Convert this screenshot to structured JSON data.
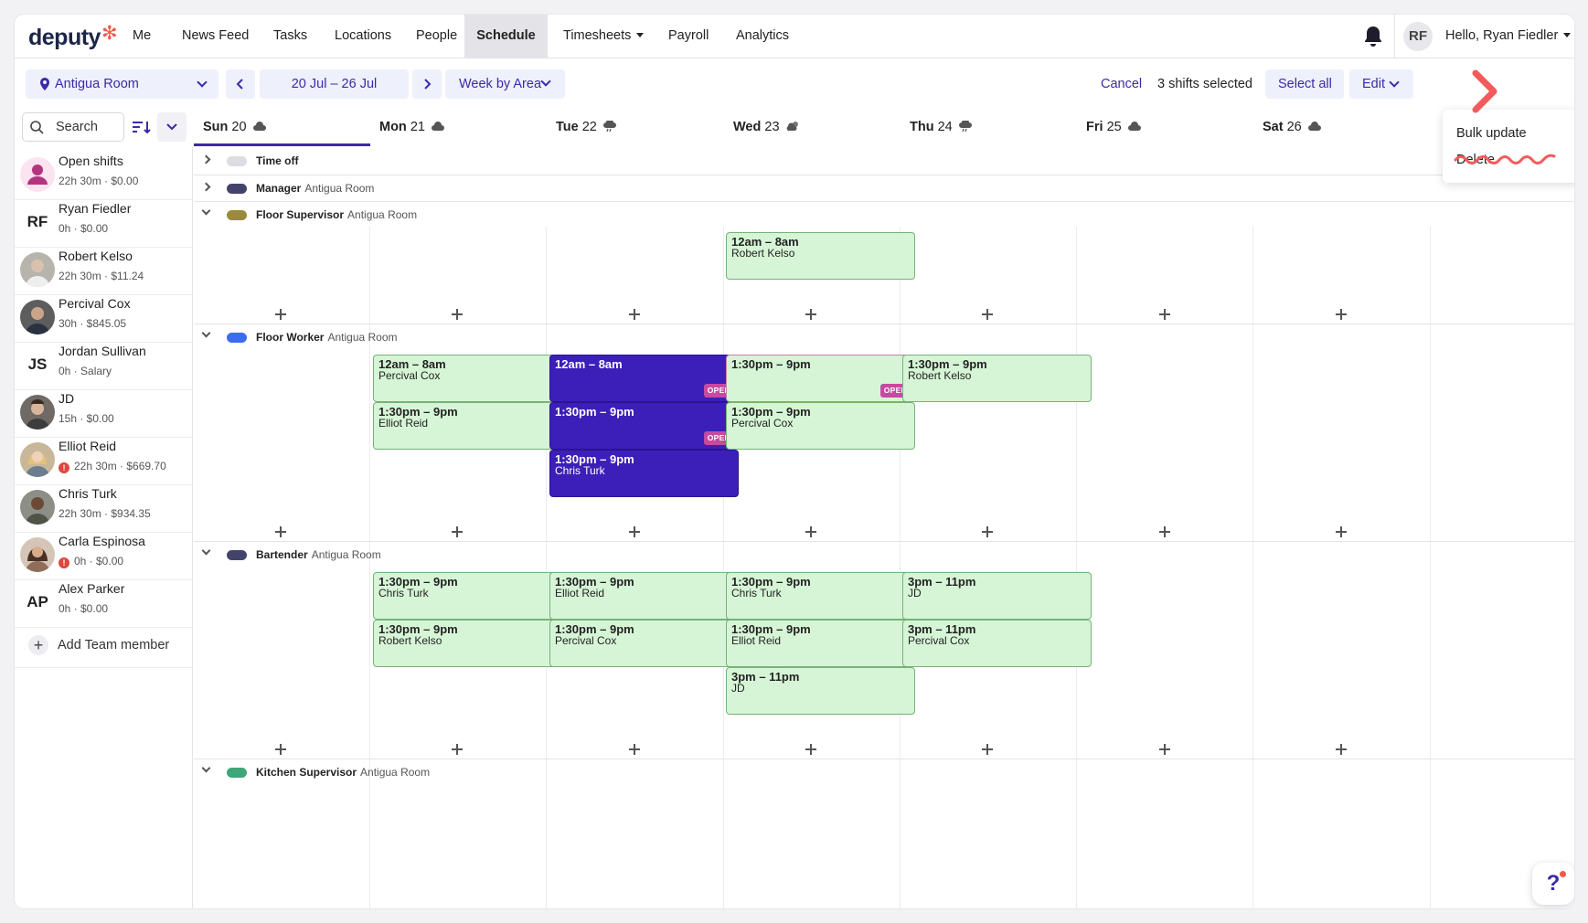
{
  "brand": {
    "name": "deputy",
    "accent": "#3c2aa8",
    "logo_star": "#f25b4b"
  },
  "nav": {
    "items": [
      {
        "label": "Me"
      },
      {
        "label": "News Feed"
      },
      {
        "label": "Tasks"
      },
      {
        "label": "Locations"
      },
      {
        "label": "People"
      },
      {
        "label": "Schedule",
        "active": true
      },
      {
        "label": "Timesheets",
        "dropdown": true
      },
      {
        "label": "Payroll"
      },
      {
        "label": "Analytics"
      }
    ],
    "user_initials": "RF",
    "greeting": "Hello, Ryan Fiedler",
    "bell_icon": "bell-icon"
  },
  "toolbar": {
    "location": "Antigua Room",
    "date_range": "20 Jul – 26 Jul",
    "view": "Week by Area",
    "cancel": "Cancel",
    "selected_count": "3 shifts selected",
    "select_all": "Select all",
    "edit": "Edit"
  },
  "edit_menu": {
    "items": [
      "Bulk update",
      "Delete"
    ]
  },
  "search": {
    "placeholder": "Search"
  },
  "days": [
    {
      "label": "Sun",
      "num": "20",
      "weather": "cloud-icon"
    },
    {
      "label": "Mon",
      "num": "21",
      "weather": "cloud-icon"
    },
    {
      "label": "Tue",
      "num": "22",
      "weather": "rain-icon"
    },
    {
      "label": "Wed",
      "num": "23",
      "weather": "partly-sunny-icon"
    },
    {
      "label": "Thu",
      "num": "24",
      "weather": "rain-icon"
    },
    {
      "label": "Fri",
      "num": "25",
      "weather": "cloud-icon"
    },
    {
      "label": "Sat",
      "num": "26",
      "weather": "cloud-icon"
    }
  ],
  "members": [
    {
      "name": "Open shifts",
      "meta": "22h 30m · $0.00",
      "avatar": "open-shifts-icon"
    },
    {
      "name": "Ryan Fiedler",
      "meta": "0h · $0.00",
      "initials": "RF"
    },
    {
      "name": "Robert Kelso",
      "meta": "22h 30m · $11.24",
      "avatar": "photo"
    },
    {
      "name": "Percival Cox",
      "meta": "30h · $845.05",
      "avatar": "photo"
    },
    {
      "name": "Jordan Sullivan",
      "meta": "0h · Salary",
      "initials": "JS"
    },
    {
      "name": "JD",
      "meta": "15h · $0.00",
      "avatar": "photo"
    },
    {
      "name": "Elliot Reid",
      "meta": "22h 30m · $669.70",
      "avatar": "photo",
      "warning": true
    },
    {
      "name": "Chris Turk",
      "meta": "22h 30m · $934.35",
      "avatar": "photo"
    },
    {
      "name": "Carla Espinosa",
      "meta": "0h · $0.00",
      "avatar": "photo",
      "warning": true
    },
    {
      "name": "Alex Parker",
      "meta": "0h · $0.00",
      "initials": "AP"
    }
  ],
  "add_member": "Add Team member",
  "areas": [
    {
      "name": "Time off",
      "location": "",
      "color": "#dcdce2"
    },
    {
      "name": "Manager",
      "location": "Antigua Room",
      "color": "#44446a"
    },
    {
      "name": "Floor Supervisor",
      "location": "Antigua Room",
      "color": "#9a8a3a"
    },
    {
      "name": "Floor Worker",
      "location": "Antigua Room",
      "color": "#3c6df0"
    },
    {
      "name": "Bartender",
      "location": "Antigua Room",
      "color": "#44446a"
    },
    {
      "name": "Kitchen Supervisor",
      "location": "Antigua Room",
      "color": "#3fa67a"
    }
  ],
  "shifts": {
    "floor_supervisor": [
      {
        "time": "12am – 8am",
        "who": "Robert Kelso"
      }
    ],
    "floor_worker": [
      {
        "time": "12am – 8am",
        "who": "Percival Cox"
      },
      {
        "time": "1:30pm – 9pm",
        "who": "Elliot Reid"
      },
      {
        "time": "12am – 8am",
        "who": "",
        "badge": "OPEN"
      },
      {
        "time": "1:30pm – 9pm",
        "who": "",
        "badge": "OPEN"
      },
      {
        "time": "1:30pm – 9pm",
        "who": "Chris Turk"
      },
      {
        "time": "1:30pm – 9pm",
        "who": "",
        "badge": "OPEN"
      },
      {
        "time": "1:30pm – 9pm",
        "who": "Percival Cox"
      },
      {
        "time": "1:30pm – 9pm",
        "who": "Robert Kelso"
      }
    ],
    "bartender": [
      {
        "time": "1:30pm – 9pm",
        "who": "Chris Turk"
      },
      {
        "time": "1:30pm – 9pm",
        "who": "Robert Kelso"
      },
      {
        "time": "1:30pm – 9pm",
        "who": "Elliot Reid"
      },
      {
        "time": "1:30pm – 9pm",
        "who": "Percival Cox"
      },
      {
        "time": "1:30pm – 9pm",
        "who": "Chris Turk"
      },
      {
        "time": "1:30pm – 9pm",
        "who": "Elliot Reid"
      },
      {
        "time": "3pm – 11pm",
        "who": "JD"
      },
      {
        "time": "3pm – 11pm",
        "who": "JD"
      },
      {
        "time": "3pm – 11pm",
        "who": "Percival Cox"
      }
    ]
  },
  "help": "?"
}
